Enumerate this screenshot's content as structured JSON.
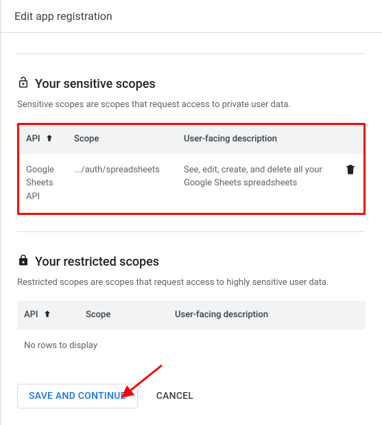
{
  "header": {
    "title": "Edit app registration"
  },
  "sensitive": {
    "title": "Your sensitive scopes",
    "desc": "Sensitive scopes are scopes that request access to private user data.",
    "columns": {
      "api": "API",
      "scope": "Scope",
      "desc": "User-facing description"
    },
    "rows": [
      {
        "api": "Google Sheets API",
        "scope": ".../auth/spreadsheets",
        "desc": "See, edit, create, and delete all your Google Sheets spreadsheets"
      }
    ]
  },
  "restricted": {
    "title": "Your restricted scopes",
    "desc": "Restricted scopes are scopes that request access to highly sensitive user data.",
    "columns": {
      "api": "API",
      "scope": "Scope",
      "desc": "User-facing description"
    },
    "empty": "No rows to display"
  },
  "actions": {
    "save": "SAVE AND CONTINUE",
    "cancel": "CANCEL"
  }
}
